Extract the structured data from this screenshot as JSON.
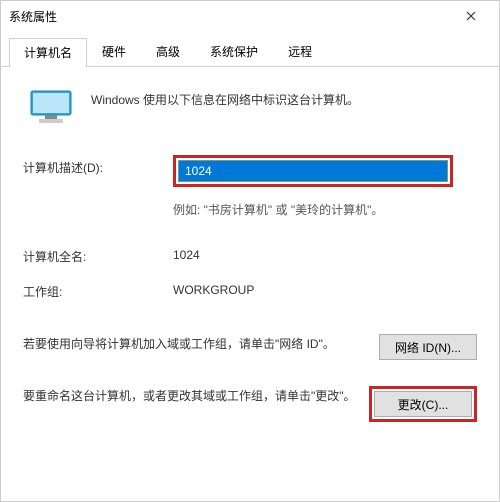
{
  "window": {
    "title": "系统属性"
  },
  "tabs": [
    {
      "label": "计算机名",
      "active": true
    },
    {
      "label": "硬件"
    },
    {
      "label": "高级"
    },
    {
      "label": "系统保护"
    },
    {
      "label": "远程"
    }
  ],
  "intro": "Windows 使用以下信息在网络中标识这台计算机。",
  "fields": {
    "description_label": "计算机描述(D):",
    "description_value": "1024",
    "example_text": "例如: \"书房计算机\" 或 \"美玲的计算机\"。",
    "fullname_label": "计算机全名:",
    "fullname_value": "1024",
    "workgroup_label": "工作组:",
    "workgroup_value": "WORKGROUP"
  },
  "actions": {
    "network_id_text": "若要使用向导将计算机加入域或工作组，请单击\"网络 ID\"。",
    "network_id_button": "网络 ID(N)...",
    "rename_text": "要重命名这台计算机，或者更改其域或工作组，请单击\"更改\"。",
    "rename_button": "更改(C)..."
  }
}
